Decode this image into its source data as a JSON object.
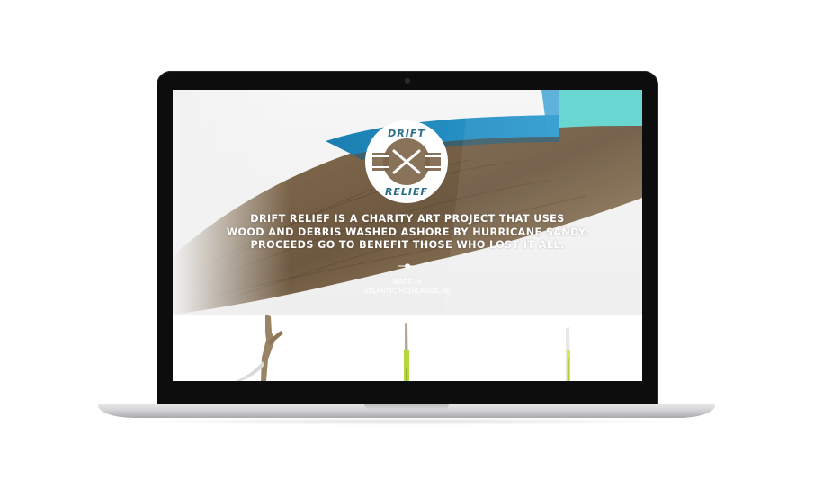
{
  "site": {
    "logo_top": "DRIFT",
    "logo_bottom": "RELIEF",
    "tagline": [
      "DRIFT RELIEF IS A CHARITY ART PROJECT THAT USES",
      "WOOD AND DEBRIS WASHED ASHORE BY HURRICANE SANDY.",
      "PROCEEDS GO TO BENEFIT THOSE WHO LOST IT ALL."
    ],
    "made_in_label": "MADE IN",
    "location": "ATLANTIC HIGHLANDS, NJ"
  },
  "colors": {
    "wood": "#7b6448",
    "wood_dark": "#4d3d2b",
    "paint_blue": "#1e8fc0",
    "paint_teal": "#5fd3cf",
    "accent_green": "#b6d83a",
    "logo_fill": "#ffffff",
    "logo_text": "#2a6f8a"
  },
  "products": [
    {
      "name": "driftwood-branch-product"
    },
    {
      "name": "green-painted-stick-product"
    },
    {
      "name": "yellow-painted-stick-product"
    }
  ]
}
